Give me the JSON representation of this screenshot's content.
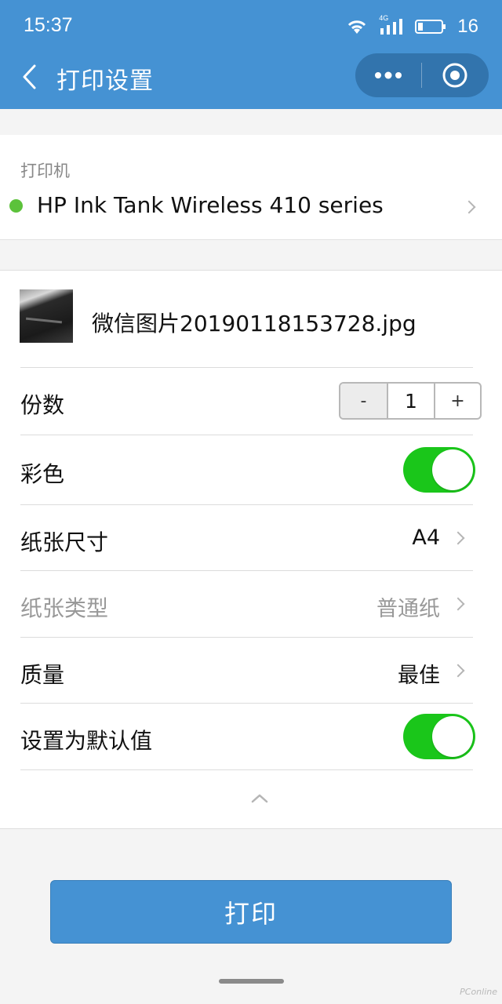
{
  "status_bar": {
    "time": "15:37",
    "network_label": "4G",
    "battery_level": "16"
  },
  "nav": {
    "title": "打印设置",
    "back_icon": "chevron-left-icon",
    "more_icon": "more-dots-icon",
    "close_icon": "target-circle-icon"
  },
  "printer": {
    "caption": "打印机",
    "name": "HP Ink Tank Wireless 410 series",
    "status_color": "#5cc23b"
  },
  "file": {
    "name": "微信图片20190118153728.jpg"
  },
  "settings": {
    "copies": {
      "label": "份数",
      "minus": "-",
      "value": "1",
      "plus": "+"
    },
    "color": {
      "label": "彩色",
      "on": true
    },
    "paper_size": {
      "label": "纸张尺寸",
      "value": "A4"
    },
    "paper_type": {
      "label": "纸张类型",
      "value": "普通纸"
    },
    "quality": {
      "label": "质量",
      "value": "最佳"
    },
    "set_default": {
      "label": "设置为默认值",
      "on": true
    }
  },
  "print_button": {
    "label": "打印"
  },
  "watermark": "PConline",
  "colors": {
    "header": "#4592d3",
    "toggle_on": "#1ac61a",
    "button": "#4592d3"
  }
}
